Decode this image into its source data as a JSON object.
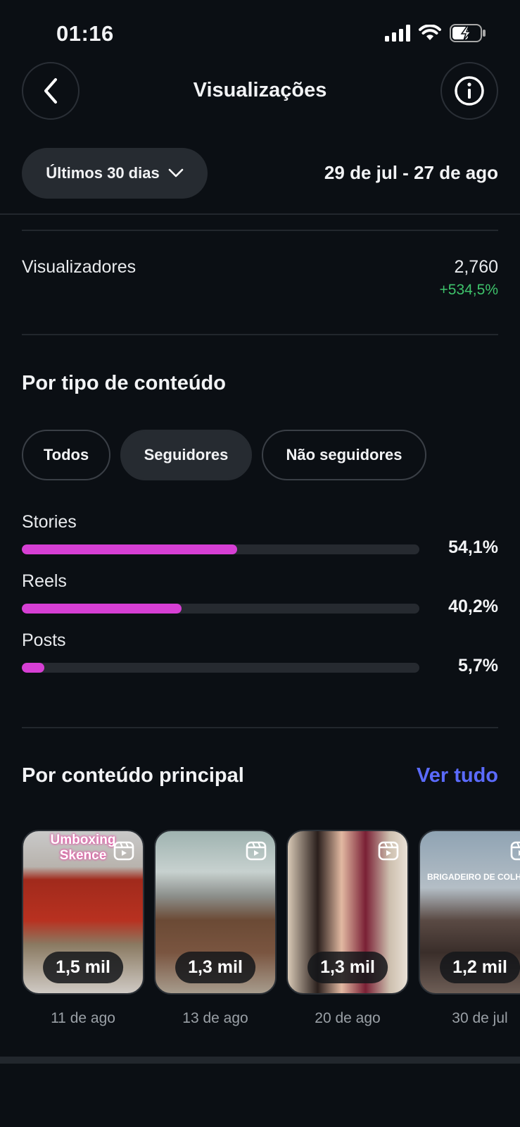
{
  "status": {
    "time": "01:16"
  },
  "header": {
    "title": "Visualizações"
  },
  "filter": {
    "period_label": "Últimos 30 dias",
    "date_range": "29 de jul - 27 de ago"
  },
  "metric": {
    "label": "Visualizadores",
    "value": "2,760",
    "change": "+534,5%",
    "change_color": "#3ec36b"
  },
  "content_type": {
    "title": "Por tipo de conteúdo",
    "chips": [
      {
        "label": "Todos",
        "active": false
      },
      {
        "label": "Seguidores",
        "active": true
      },
      {
        "label": "Não seguidores",
        "active": false
      }
    ],
    "bars": [
      {
        "label": "Stories",
        "percent_text": "54,1%",
        "fraction": 0.541
      },
      {
        "label": "Reels",
        "percent_text": "40,2%",
        "fraction": 0.402
      },
      {
        "label": "Posts",
        "percent_text": "5,7%",
        "fraction": 0.057
      }
    ],
    "bar_color": "#d63fd4"
  },
  "top_content": {
    "title": "Por conteúdo principal",
    "see_all": "Ver tudo",
    "see_all_color": "#5b6bff",
    "items": [
      {
        "count": "1,5 mil",
        "date": "11 de ago",
        "overlay_text": "Umboxing Skence",
        "reel_icon": "reel-icon"
      },
      {
        "count": "1,3 mil",
        "date": "13 de ago",
        "overlay_text": "",
        "reel_icon": "reel-icon"
      },
      {
        "count": "1,3 mil",
        "date": "20 de ago",
        "overlay_text": "",
        "reel_icon": "reel-icon"
      },
      {
        "count": "1,2 mil",
        "date": "30 de jul",
        "overlay_text": "BRIGADEIRO DE COLH",
        "reel_icon": "reel-icon"
      }
    ]
  }
}
